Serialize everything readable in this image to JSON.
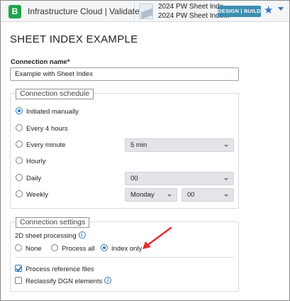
{
  "header": {
    "logo_letter": "B",
    "app_title": "Infrastructure Cloud | Validate",
    "project_line1": "2024 PW Sheet Inde...",
    "project_line2": "2024 PW Sheet Inde...",
    "badge": "DESIGN | BUILD",
    "favorite_icon": "star-icon",
    "menu_icon": "caret-down-icon"
  },
  "page": {
    "title": "SHEET INDEX EXAMPLE",
    "connection_name_label": "Connection name*",
    "connection_name_value": "Example with Sheet Index"
  },
  "schedule": {
    "title": "Connection schedule",
    "options": [
      {
        "label": "Initiated manually",
        "checked": true
      },
      {
        "label": "Every 4 hours",
        "checked": false
      },
      {
        "label": "Every minute",
        "checked": false
      },
      {
        "label": "Hourly",
        "checked": false
      },
      {
        "label": "Daily",
        "checked": false
      },
      {
        "label": "Weekly",
        "checked": false
      }
    ],
    "every_minute_select": "5 min",
    "daily_select": "00",
    "weekly_day_select": "Monday",
    "weekly_time_select": "00"
  },
  "settings": {
    "title": "Connection settings",
    "sheet_processing_label": "2D sheet processing",
    "sheet_options": [
      {
        "label": "None",
        "checked": false
      },
      {
        "label": "Process all",
        "checked": false
      },
      {
        "label": "Index only",
        "checked": true
      }
    ],
    "process_reference_files": {
      "label": "Process reference files",
      "checked": true
    },
    "reclassify_dgn": {
      "label": "Reclassify DGN elements",
      "checked": false
    }
  },
  "colors": {
    "accent": "#2b78c2",
    "logo": "#1fa34a",
    "badge": "#3d8fb3",
    "arrow": "#e0322d"
  }
}
